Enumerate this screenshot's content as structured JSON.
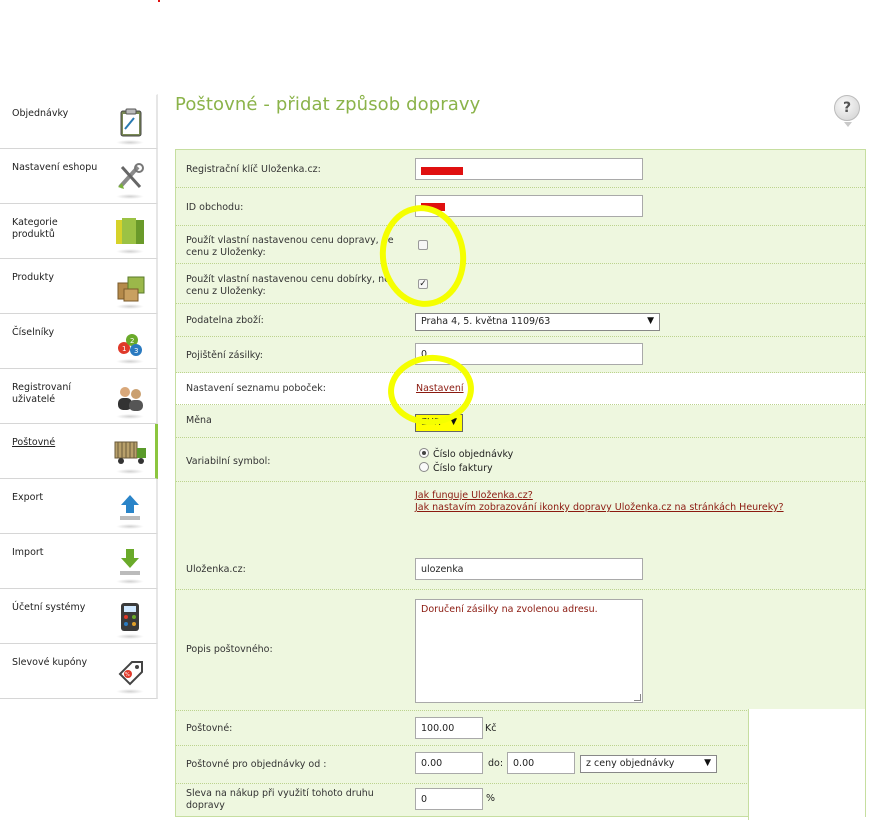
{
  "sidebar": {
    "items": [
      {
        "label": "Objednávky",
        "icon": "clipboard-icon"
      },
      {
        "label": "Nastavení eshopu",
        "icon": "tools-icon"
      },
      {
        "label": "Kategorie produktů",
        "icon": "folder-icon"
      },
      {
        "label": "Produkty",
        "icon": "boxes-icon"
      },
      {
        "label": "Číselníky",
        "icon": "numbers-icon"
      },
      {
        "label": "Registrovaní uživatelé",
        "icon": "users-icon"
      },
      {
        "label": "Poštovné",
        "icon": "truck-icon",
        "active": true
      },
      {
        "label": "Export",
        "icon": "upload-icon"
      },
      {
        "label": "Import",
        "icon": "download-icon"
      },
      {
        "label": "Účetní systémy",
        "icon": "calculator-icon"
      },
      {
        "label": "Slevové kupóny",
        "icon": "coupon-icon"
      }
    ]
  },
  "page": {
    "title": "Poštovné - přidat způsob dopravy",
    "help_label": "?"
  },
  "form": {
    "reg_key_label": "Registrační klíč Uloženka.cz:",
    "shop_id_label": "ID obchodu:",
    "own_price_label": "Použít vlastní nastavenou cenu dopravy, ne cenu z Uloženky:",
    "own_price_checked": false,
    "own_cod_label": "Použít vlastní nastavenou cenu dobírky, ne cenu z Uloženky:",
    "own_cod_checked": true,
    "branch_label": "Podatelna zboží:",
    "branch_value": "Praha 4, 5. května 1109/63",
    "insurance_label": "Pojištění zásilky:",
    "insurance_value": "0",
    "branch_list_label": "Nastavení seznamu poboček:",
    "branch_list_link": "Nastavení",
    "currency_label": "Měna",
    "currency_value": "EUR",
    "variable_symbol_label": "Variabilní symbol:",
    "vs_options": [
      "Číslo objednávky",
      "Číslo faktury"
    ],
    "vs_selected": 0,
    "help_link_1": "Jak funguje Uloženka.cz?",
    "help_link_2": "Jak nastavím zobrazování ikonky dopravy Uloženka.cz na stránkách Heureky?",
    "ulozenka_label": "Uloženka.cz:",
    "ulozenka_value": "ulozenka",
    "description_label": "Popis poštovného:",
    "description_value": "Doručení zásilky na zvolenou adresu.",
    "postage_label": "Poštovné:",
    "postage_value": "100.00",
    "postage_unit": "Kč",
    "postage_from_label": "Poštovné pro objednávky od :",
    "postage_from_value": "0.00",
    "postage_to_label": "do:",
    "postage_to_value": "0.00",
    "postage_basis_value": "z ceny objednávky",
    "discount_label": "Sleva na nákup při využití tohoto druhu dopravy",
    "discount_value": "0",
    "discount_unit": "%"
  },
  "colors": {
    "title_green": "#8bb34a",
    "form_bg": "#eef7df",
    "highlight_yellow": "#f5ff00",
    "link_red": "#8b1a10"
  }
}
